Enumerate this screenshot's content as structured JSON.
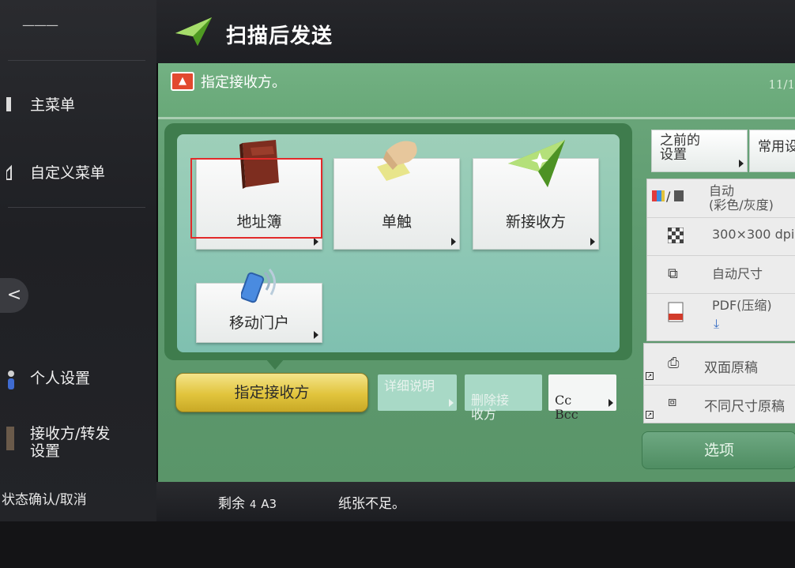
{
  "header": {
    "title": "扫描后发送"
  },
  "sidebar": {
    "top_mark": "———",
    "items": [
      {
        "label": "主菜单"
      },
      {
        "label": "自定义菜单"
      },
      {
        "label": "个人设置"
      },
      {
        "label": "接收方/转发\n设置"
      }
    ],
    "nav_label": "<",
    "bottom_label": "状态确认/取消"
  },
  "message": {
    "text": "指定接收方。",
    "page": "11/1"
  },
  "dest_tiles": [
    {
      "label": "地址簿",
      "icon": "address-book-icon"
    },
    {
      "label": "单触",
      "icon": "one-touch-icon"
    },
    {
      "label": "新接收方",
      "icon": "paper-plane-icon"
    },
    {
      "label": "移动门户",
      "icon": "mobile-portal-icon"
    }
  ],
  "bottom_buttons": {
    "primary": "指定接收方",
    "details": "详细说明",
    "delete": "删除接\n收方",
    "cc": "Cc\nBcc"
  },
  "right_panel": {
    "prev_settings": "之前的\n设置",
    "favorites": "常用设",
    "color": "自动\n(彩色/灰度)",
    "resolution": "300×300 dpi",
    "size": "自动尺寸",
    "format": "PDF(压缩)",
    "duplex": "双面原稿",
    "mixed": "不同尺寸原稿",
    "options": "选项"
  },
  "status": {
    "remain_label": "剩余",
    "remain_count": "4",
    "paper": "A3",
    "message": "纸张不足。"
  },
  "colors": {
    "panel_green": "#5f9b70",
    "primary_yellow": "#e1c43c",
    "highlight_red": "#e22a2a"
  }
}
